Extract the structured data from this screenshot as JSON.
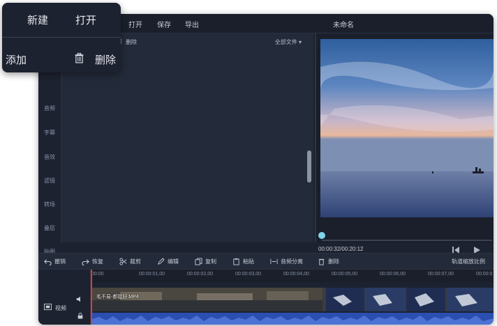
{
  "menubar": {
    "items": [
      "打开",
      "保存",
      "导出"
    ],
    "doc_title": "未命名"
  },
  "popup": {
    "new": "新建",
    "open": "打开",
    "add": "添加",
    "delete": "删除"
  },
  "leftnav": {
    "items": [
      "音频",
      "字幕",
      "音效",
      "滤镜",
      "转场",
      "叠层",
      "贴图"
    ]
  },
  "media": {
    "delete_label": "删除",
    "filter_label": "全部文件 ▾"
  },
  "preview": {
    "timecode": "00:00:32/00:20:12",
    "progress_fraction": 0.0
  },
  "toolbar": {
    "undo": "撤销",
    "redo": "恢复",
    "crop": "裁剪",
    "edit": "编辑",
    "copy": "复制",
    "paste": "粘贴",
    "audio_split": "音频分离",
    "delete": "删除",
    "zoom_ratio": "轨道缩放比例"
  },
  "timeline": {
    "ticks": [
      "00:00",
      "00:00:01,00",
      "00:00:02,00",
      "00:00:03,00",
      "00:00:04,00",
      "00:00:05,00",
      "00:00:06,00",
      "00:00:07,00",
      "00:00:0"
    ],
    "track_label": "视频",
    "clip_label": "毛不易-都挺好.MP4"
  },
  "colors": {
    "window_bg": "#1d2230",
    "accent": "#7fd3ea",
    "playhead": "#e23b3b",
    "waveform": "#2a4fb0"
  }
}
